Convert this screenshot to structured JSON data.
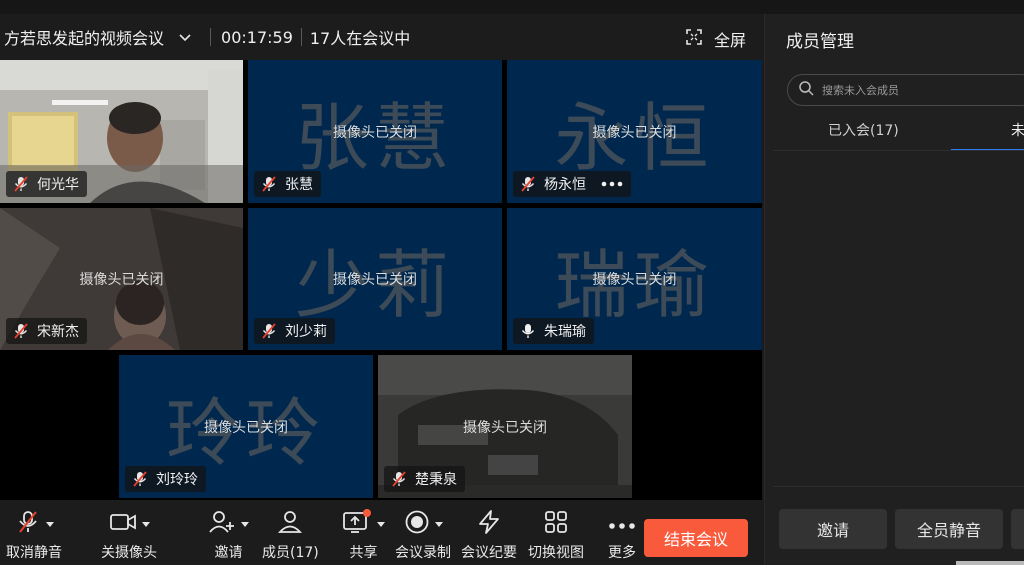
{
  "header": {
    "meeting_title": "方若思发起的视频会议",
    "timer": "00:17:59",
    "participant_count": "17人在会议中",
    "fullscreen_label": "全屏"
  },
  "tiles": [
    {
      "name": "何光华",
      "camera_status": "",
      "big_name": "",
      "mic": "muted"
    },
    {
      "name": "张慧",
      "camera_status": "摄像头已关闭",
      "big_name": "张慧",
      "mic": "muted"
    },
    {
      "name": "杨永恒",
      "camera_status": "摄像头已关闭",
      "big_name": "永恒",
      "mic": "muted"
    },
    {
      "name": "宋新杰",
      "camera_status": "摄像头已关闭",
      "big_name": "",
      "mic": "muted"
    },
    {
      "name": "刘少莉",
      "camera_status": "摄像头已关闭",
      "big_name": "少莉",
      "mic": "muted"
    },
    {
      "name": "朱瑞瑜",
      "camera_status": "摄像头已关闭",
      "big_name": "瑞瑜",
      "mic": "on"
    },
    {
      "name": "刘玲玲",
      "camera_status": "摄像头已关闭",
      "big_name": "玲玲",
      "mic": "muted"
    },
    {
      "name": "楚秉泉",
      "camera_status": "摄像头已关闭",
      "big_name": "",
      "mic": "muted"
    }
  ],
  "toolbar": {
    "mute_label": "取消静音",
    "camera_label": "关摄像头",
    "invite_label": "邀请",
    "members_label": "成员(17)",
    "share_label": "共享",
    "record_label": "会议录制",
    "minutes_label": "会议纪要",
    "switch_view_label": "切换视图",
    "more_label": "更多",
    "end_label": "结束会议"
  },
  "panel": {
    "title": "成员管理",
    "search_placeholder": "搜索未入会成员",
    "tab_joined": "已入会(17)",
    "tab_not_joined": "未",
    "invite_button": "邀请",
    "mute_all_button": "全员静音"
  },
  "colors": {
    "tile_bg": "#00274d",
    "accent_blue": "#2f7cf6",
    "end_button": "#fa5a3c",
    "muted_red": "#e8402e"
  },
  "icons": {
    "muted_mic": "mic-off-icon",
    "mic_on": "mic-icon",
    "fullscreen": "fullscreen-icon",
    "dropdown": "chevron-down-icon",
    "search": "search-icon"
  }
}
